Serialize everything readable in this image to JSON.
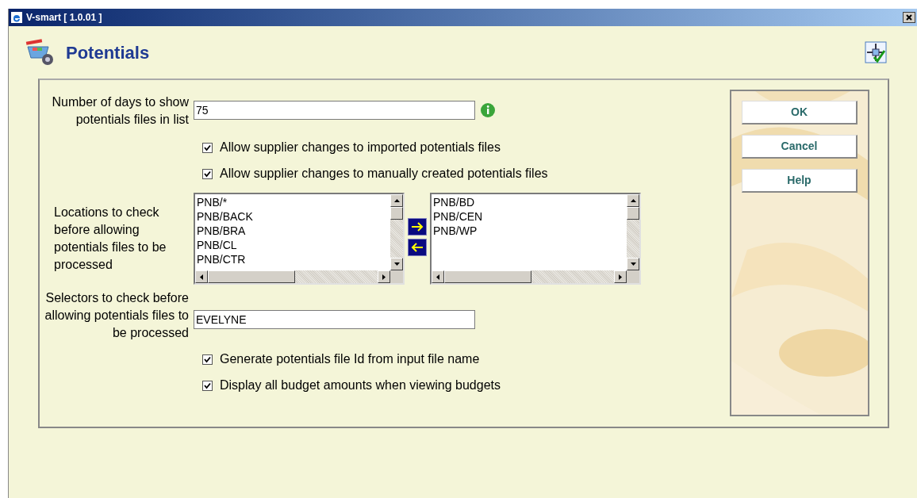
{
  "window": {
    "title": "V-smart [ 1.0.01 ]"
  },
  "header": {
    "title": "Potentials"
  },
  "days_field": {
    "label": "Number of days to show potentials files in list",
    "value": "75"
  },
  "options_top": [
    {
      "label": "Allow supplier changes to imported potentials files",
      "checked": true
    },
    {
      "label": "Allow supplier changes to manually created potentials files",
      "checked": true
    }
  ],
  "locations": {
    "label": "Locations to check before allowing potentials files to be processed",
    "available": [
      "PNB/*",
      "PNB/BACK",
      "PNB/BRA",
      "PNB/CL",
      "PNB/CTR"
    ],
    "chosen": [
      "PNB/BD",
      "PNB/CEN",
      "PNB/WP"
    ]
  },
  "selectors_field": {
    "label": "Selectors to check before allowing potentials files to be processed",
    "value": "EVELYNE"
  },
  "options_bottom": [
    {
      "label": "Generate potentials file Id from input file name",
      "checked": true
    },
    {
      "label": "Display all budget amounts when viewing budgets",
      "checked": true
    }
  ],
  "buttons": [
    "OK",
    "Cancel",
    "Help"
  ]
}
